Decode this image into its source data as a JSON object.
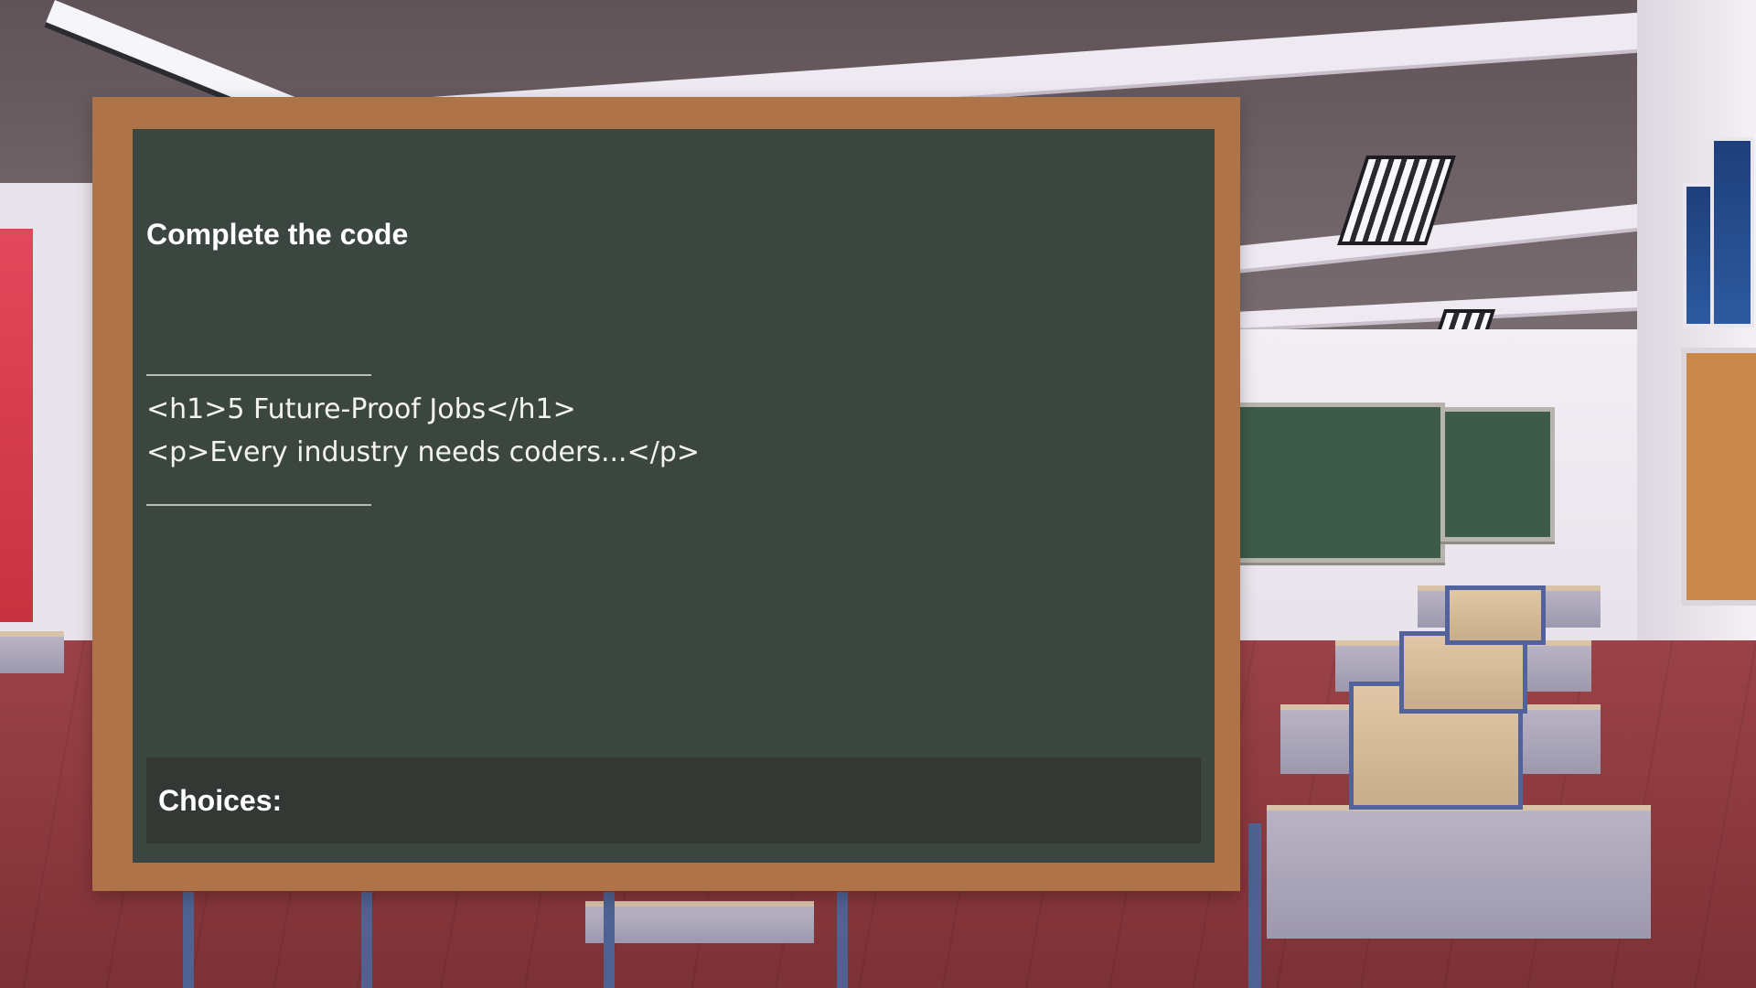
{
  "scene": {
    "background": "classroom",
    "colors": {
      "frame": "#ae7448",
      "board": "#3c4640",
      "choices_panel": "#333834",
      "text": "#ffffff"
    }
  },
  "question": {
    "title": "Complete the code",
    "code_lines": [
      "<h1>5 Future-Proof Jobs</h1>",
      "<p>Every industry needs coders...</p>"
    ]
  },
  "choices": {
    "label": "Choices:",
    "options": []
  }
}
